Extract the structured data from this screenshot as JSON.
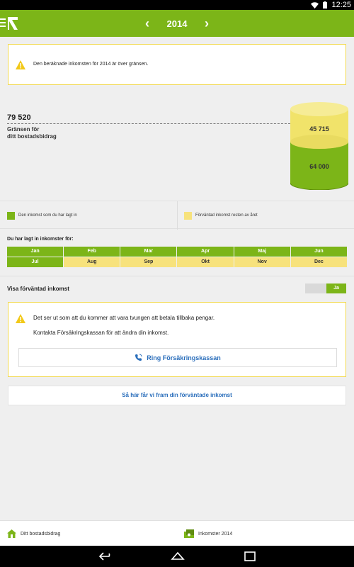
{
  "status_bar": {
    "time": "12:25"
  },
  "header": {
    "year": "2014",
    "prev_icon": "chevron-left-icon",
    "next_icon": "chevron-right-icon",
    "colors": {
      "brand_green": "#7cb518"
    }
  },
  "notice_top": {
    "text": "Den beräknade inkomsten för 2014 är över gränsen."
  },
  "limit": {
    "value": "79 520",
    "label_line1": "Gränsen för",
    "label_line2": "ditt bostadsbidrag"
  },
  "cylinder": {
    "expected_value": "45 715",
    "reported_value": "64 000",
    "colors": {
      "reported": "#7cb518",
      "expected": "#f1e36a"
    }
  },
  "legend": {
    "reported": "Den inkomst som du har lagt in",
    "expected": "Förväntad inkomst resten av året"
  },
  "months": {
    "title": "Du har lagt in inkomster för:",
    "items": [
      {
        "label": "Jan",
        "state": "reported"
      },
      {
        "label": "Feb",
        "state": "reported"
      },
      {
        "label": "Mar",
        "state": "reported"
      },
      {
        "label": "Apr",
        "state": "reported"
      },
      {
        "label": "Maj",
        "state": "reported"
      },
      {
        "label": "Jun",
        "state": "reported"
      },
      {
        "label": "Jul",
        "state": "reported"
      },
      {
        "label": "Aug",
        "state": "expected"
      },
      {
        "label": "Sep",
        "state": "expected"
      },
      {
        "label": "Okt",
        "state": "expected"
      },
      {
        "label": "Nov",
        "state": "expected"
      },
      {
        "label": "Dec",
        "state": "expected"
      }
    ]
  },
  "show_expected": {
    "label": "Visa förväntad inkomst",
    "toggle_value": "Ja"
  },
  "notice_repay": {
    "line1": "Det ser ut som att du kommer att vara tvungen att betala tillbaka pengar.",
    "line2": "Kontakta Försäkringskassan för att ändra din inkomst.",
    "call_label": "Ring Försäkringskassan"
  },
  "how_link": "Så här får vi fram din förväntade inkomst",
  "bottom_nav": {
    "left": {
      "label": "Ditt bostadsbidrag",
      "icon": "house-icon"
    },
    "right": {
      "label": "Inkomster 2014",
      "icon": "money-icon"
    }
  }
}
